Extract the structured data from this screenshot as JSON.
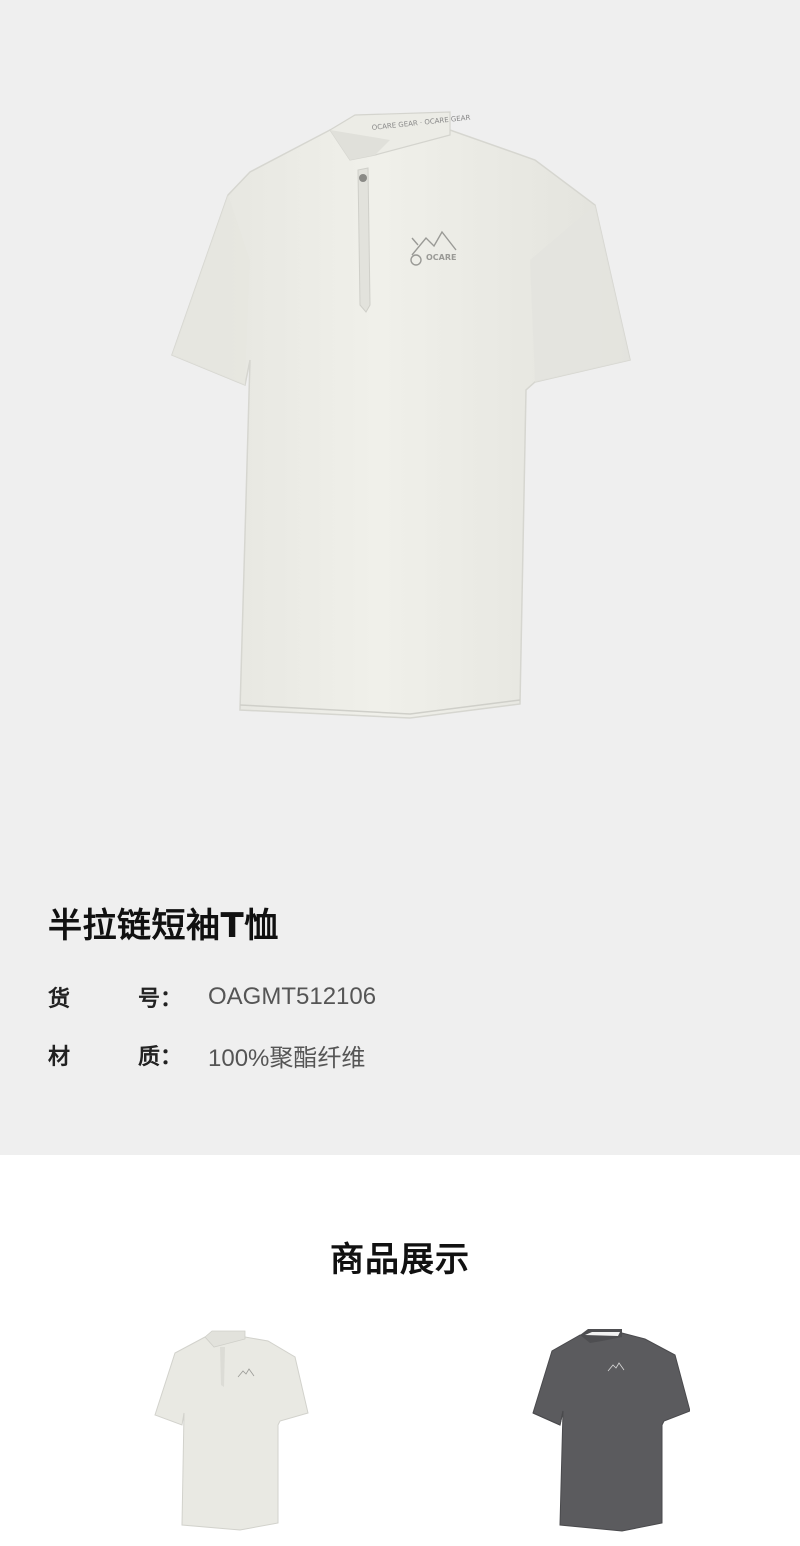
{
  "product": {
    "title": "半拉链短袖T恤",
    "specs": [
      {
        "label_1": "货",
        "label_2": "号：",
        "value": "OAGMT512106"
      },
      {
        "label_1": "材",
        "label_2": "质：",
        "value": "100%聚酯纤维"
      }
    ]
  },
  "showcase": {
    "title": "商品展示",
    "items": [
      {
        "variant": "white"
      },
      {
        "variant": "dark-grey"
      }
    ]
  },
  "colors": {
    "hero_background": "#efefef",
    "shirt_white": "#e9e9e3",
    "shirt_grey": "#5b5b5e"
  }
}
